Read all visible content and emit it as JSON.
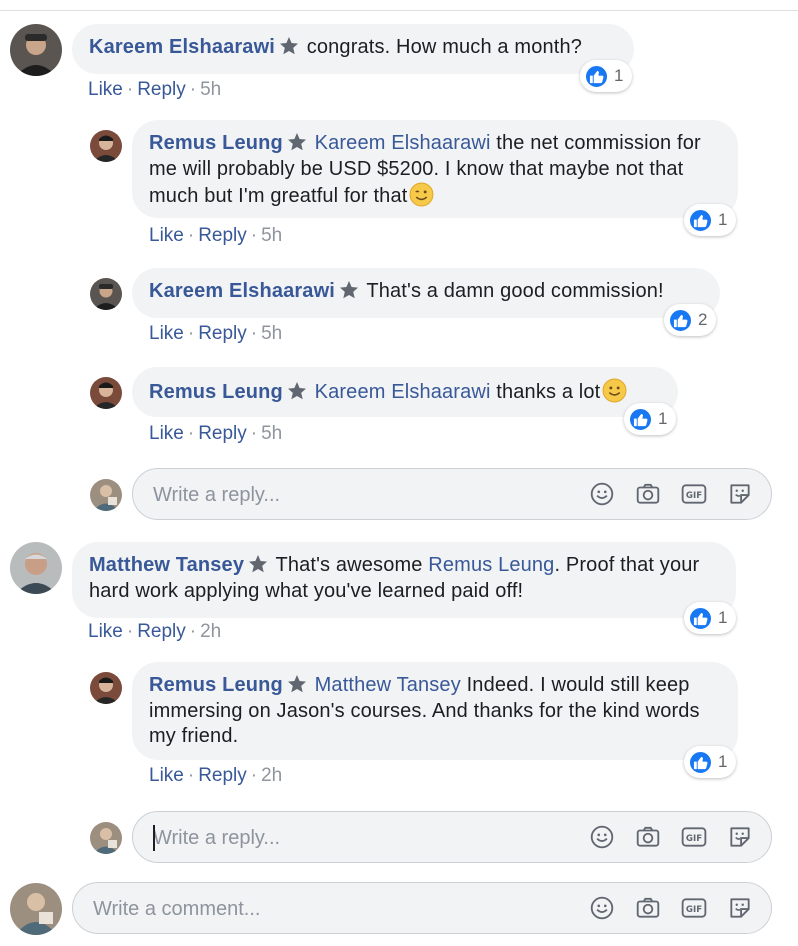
{
  "comments": [
    {
      "author": "Kareem Elshaarawi",
      "text": "congrats. How much a month?",
      "actions": {
        "like": "Like",
        "reply": "Reply",
        "time": "5h"
      },
      "reactions": "1"
    },
    {
      "author": "Remus Leung",
      "mention": "Kareem Elshaarawi",
      "text": "the net commission for me will probably be USD $5200. I know that maybe not that much but I'm greatful for that",
      "emoji": "wink-emoji",
      "actions": {
        "like": "Like",
        "reply": "Reply",
        "time": "5h"
      },
      "reactions": "1"
    },
    {
      "author": "Kareem Elshaarawi",
      "text": "That's a damn good commission!",
      "actions": {
        "like": "Like",
        "reply": "Reply",
        "time": "5h"
      },
      "reactions": "2"
    },
    {
      "author": "Remus Leung",
      "mention": "Kareem Elshaarawi",
      "text": "thanks a lot",
      "emoji": "smile-emoji",
      "actions": {
        "like": "Like",
        "reply": "Reply",
        "time": "5h"
      },
      "reactions": "1"
    },
    {
      "author": "Matthew Tansey",
      "text_before": "That's awesome",
      "mention": "Remus Leung",
      "text": ". Proof that your hard work applying what you've learned paid off!",
      "actions": {
        "like": "Like",
        "reply": "Reply",
        "time": "2h"
      },
      "reactions": "1"
    },
    {
      "author": "Remus Leung",
      "mention": "Matthew Tansey",
      "text": "Indeed. I would still keep immersing on Jason's courses. And thanks for the kind words my friend.",
      "actions": {
        "like": "Like",
        "reply": "Reply",
        "time": "2h"
      },
      "reactions": "1"
    }
  ],
  "reply_placeholder": "Write a reply...",
  "comment_placeholder": "Write a comment...",
  "tool_icons": [
    "emoji-icon",
    "camera-icon",
    "gif-icon",
    "sticker-icon"
  ],
  "colors": {
    "link": "#385898",
    "bubble": "#f2f3f5",
    "like_blue": "#1877f2",
    "muted": "#90949c"
  }
}
